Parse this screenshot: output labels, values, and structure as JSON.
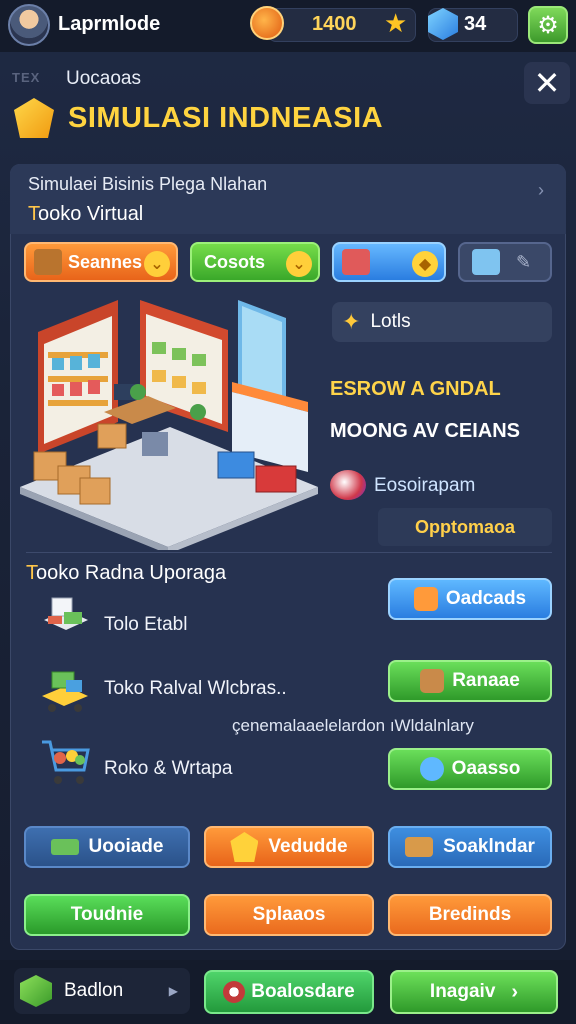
{
  "topbar": {
    "username": "Laprmlode",
    "coins": "1400",
    "gems": "34"
  },
  "header": {
    "tag": "TEX",
    "subtitle": "Uocaoas",
    "title": "SIMULASI INDNEASIA"
  },
  "panel": {
    "subtitle": "Simulaei Bisinis Plega Nlahan",
    "store_title_first": "T",
    "store_title_rest": "ooko Virtual",
    "categories": [
      {
        "label": "Seannes"
      },
      {
        "label": "Cosots"
      },
      {
        "label": ""
      },
      {
        "label": ""
      }
    ]
  },
  "info": {
    "lots_label": "Lotls",
    "line1": "ESROW A GNDAL",
    "line2": "MOONG AV CEIANS",
    "eco_label": "Eosoirapam",
    "opp_label": "Opptomaoa"
  },
  "upgrades": {
    "section_title_first": "T",
    "section_title_rest": "ooko Radna Uporaga",
    "caption": "çenemalaaelelardon ıWldalnlary",
    "items": [
      {
        "label": "Tolo Etabl",
        "button": "Oadcads"
      },
      {
        "label": "Toko Ralval Wlcbras..",
        "button": "Ranaae"
      },
      {
        "label": "Roko & Wrtapa",
        "button": "Oaasso"
      }
    ]
  },
  "actions": {
    "row1": [
      "Uooiade",
      "Vedudde",
      "Soaklndar"
    ],
    "row2": [
      "Toudnie",
      "Splaaos",
      "Bredinds"
    ]
  },
  "bottombar": {
    "left": "Badlon",
    "mid": "Boalosdare",
    "right": "Inagaiv"
  },
  "colors": {
    "gold": "#ffd440",
    "orange": "#f07a2a",
    "green": "#3fbf4a",
    "blue": "#2f8fe0"
  }
}
